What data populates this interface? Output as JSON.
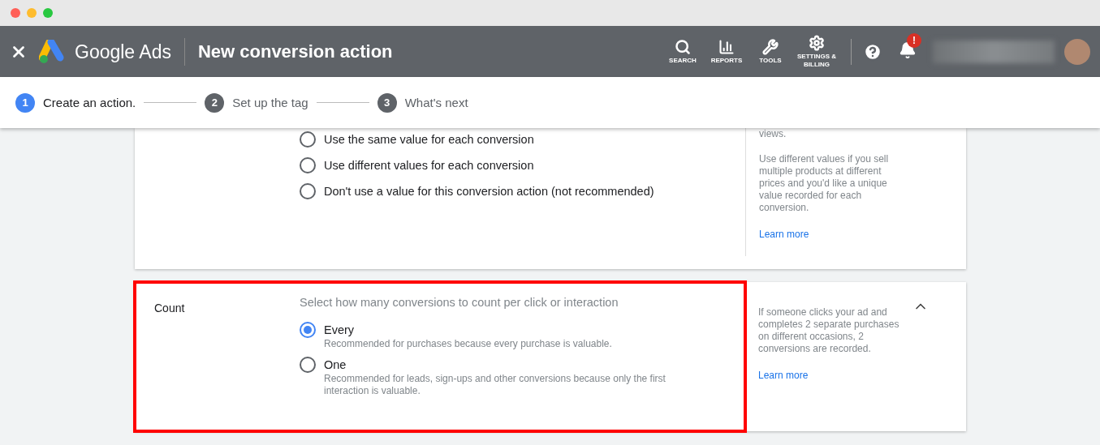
{
  "header": {
    "brand": "Google Ads",
    "title": "New conversion action",
    "nav": [
      {
        "kind": "search",
        "label": "SEARCH"
      },
      {
        "kind": "reports",
        "label": "REPORTS"
      },
      {
        "kind": "tools",
        "label": "TOOLS"
      },
      {
        "kind": "settings",
        "label": "SETTINGS & BILLING"
      }
    ],
    "notification_badge": "!"
  },
  "steps": [
    {
      "number": "1",
      "label": "Create an action.",
      "selected": true
    },
    {
      "number": "2",
      "label": "Set up the tag",
      "selected": false
    },
    {
      "number": "3",
      "label": "What's next",
      "selected": false
    }
  ],
  "value_section": {
    "options": [
      {
        "label": "Use the same value for each conversion",
        "selected": false
      },
      {
        "label": "Use different values for each conversion",
        "selected": false
      },
      {
        "label": "Don't use a value for this conversion action (not recommended)",
        "selected": false
      }
    ],
    "help": [
      "views.",
      "Use different values if you sell multiple products at different prices and you'd like a unique value recorded for each conversion."
    ],
    "link": "Learn more"
  },
  "count_section": {
    "label": "Count",
    "highlighted": true,
    "expanded": true,
    "prompt": "Select how many conversions to count per click or interaction",
    "options": [
      {
        "label": "Every",
        "description": "Recommended for purchases because every purchase is valuable.",
        "selected": true
      },
      {
        "label": "One",
        "description": "Recommended for leads, sign-ups and other conversions because only the first interaction is valuable.",
        "selected": false
      }
    ],
    "help": [
      "If someone clicks your ad and completes 2 separate purchases on different occasions, 2 conversions are recorded."
    ],
    "link": "Learn more"
  }
}
